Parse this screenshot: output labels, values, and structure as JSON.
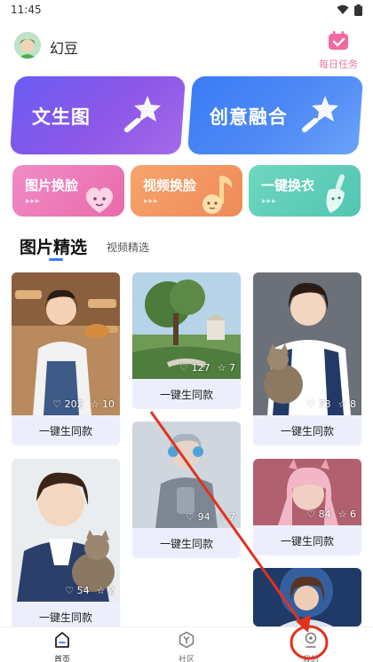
{
  "status": {
    "time": "11:45"
  },
  "header": {
    "username": "幻豆",
    "daily_task": "每日任务"
  },
  "features": {
    "text_to_image": "文生图",
    "creative_fusion": "创意融合",
    "image_face_swap": "图片换脸",
    "video_face_swap": "视频换脸",
    "outfit_swap": "一键换衣",
    "arrows": "▸▸▸"
  },
  "tabs": {
    "selected": "图片精选",
    "other": "视频精选"
  },
  "gallery": [
    {
      "likes": "202",
      "stars": "10",
      "button": "一键生同款"
    },
    {
      "likes": "127",
      "stars": "7",
      "button": "一键生同款"
    },
    {
      "likes": "73",
      "stars": "8",
      "button": "一键生同款"
    },
    {
      "likes": "94",
      "stars": "7",
      "button": "一键生同款"
    },
    {
      "likes": "84",
      "stars": "6",
      "button": "一键生同款"
    },
    {
      "likes": "54",
      "stars": "2",
      "button": "一键生同款"
    }
  ],
  "nav": {
    "home": "首页",
    "community": "社区",
    "mine": "我的"
  },
  "colors": {
    "accent": "#3d78f0",
    "annotation": "#e0321e",
    "pink": "#ee7ba0"
  }
}
